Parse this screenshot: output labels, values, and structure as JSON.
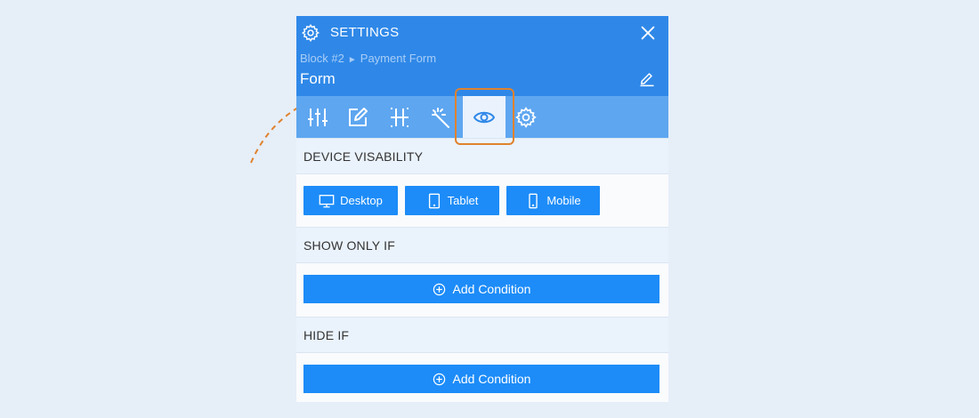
{
  "header": {
    "title": "SETTINGS",
    "breadcrumb": [
      "Block #2",
      "Payment Form"
    ],
    "breadcrumb_separator": "►",
    "form_title": "Form"
  },
  "toolbar": {
    "tools": [
      {
        "icon": "sliders-icon"
      },
      {
        "icon": "edit-icon"
      },
      {
        "icon": "layout-grid-icon"
      },
      {
        "icon": "magic-wand-icon"
      },
      {
        "icon": "eye-icon",
        "active": true
      },
      {
        "icon": "gear-icon"
      }
    ]
  },
  "device_visibility": {
    "heading": "DEVICE VISABILITY",
    "buttons": [
      {
        "label": "Desktop",
        "icon": "desktop-icon"
      },
      {
        "label": "Tablet",
        "icon": "tablet-icon"
      },
      {
        "label": "Mobile",
        "icon": "mobile-icon"
      }
    ]
  },
  "show_only_if": {
    "heading": "SHOW ONLY IF",
    "button_label": "Add Condition"
  },
  "hide_if": {
    "heading": "HIDE IF",
    "button_label": "Add Condition"
  },
  "colors": {
    "header": "#2f88e8",
    "toolbar": "#5ea6f0",
    "button": "#1d8cf8",
    "highlight": "#e0822e",
    "background": "#e6eef8"
  }
}
